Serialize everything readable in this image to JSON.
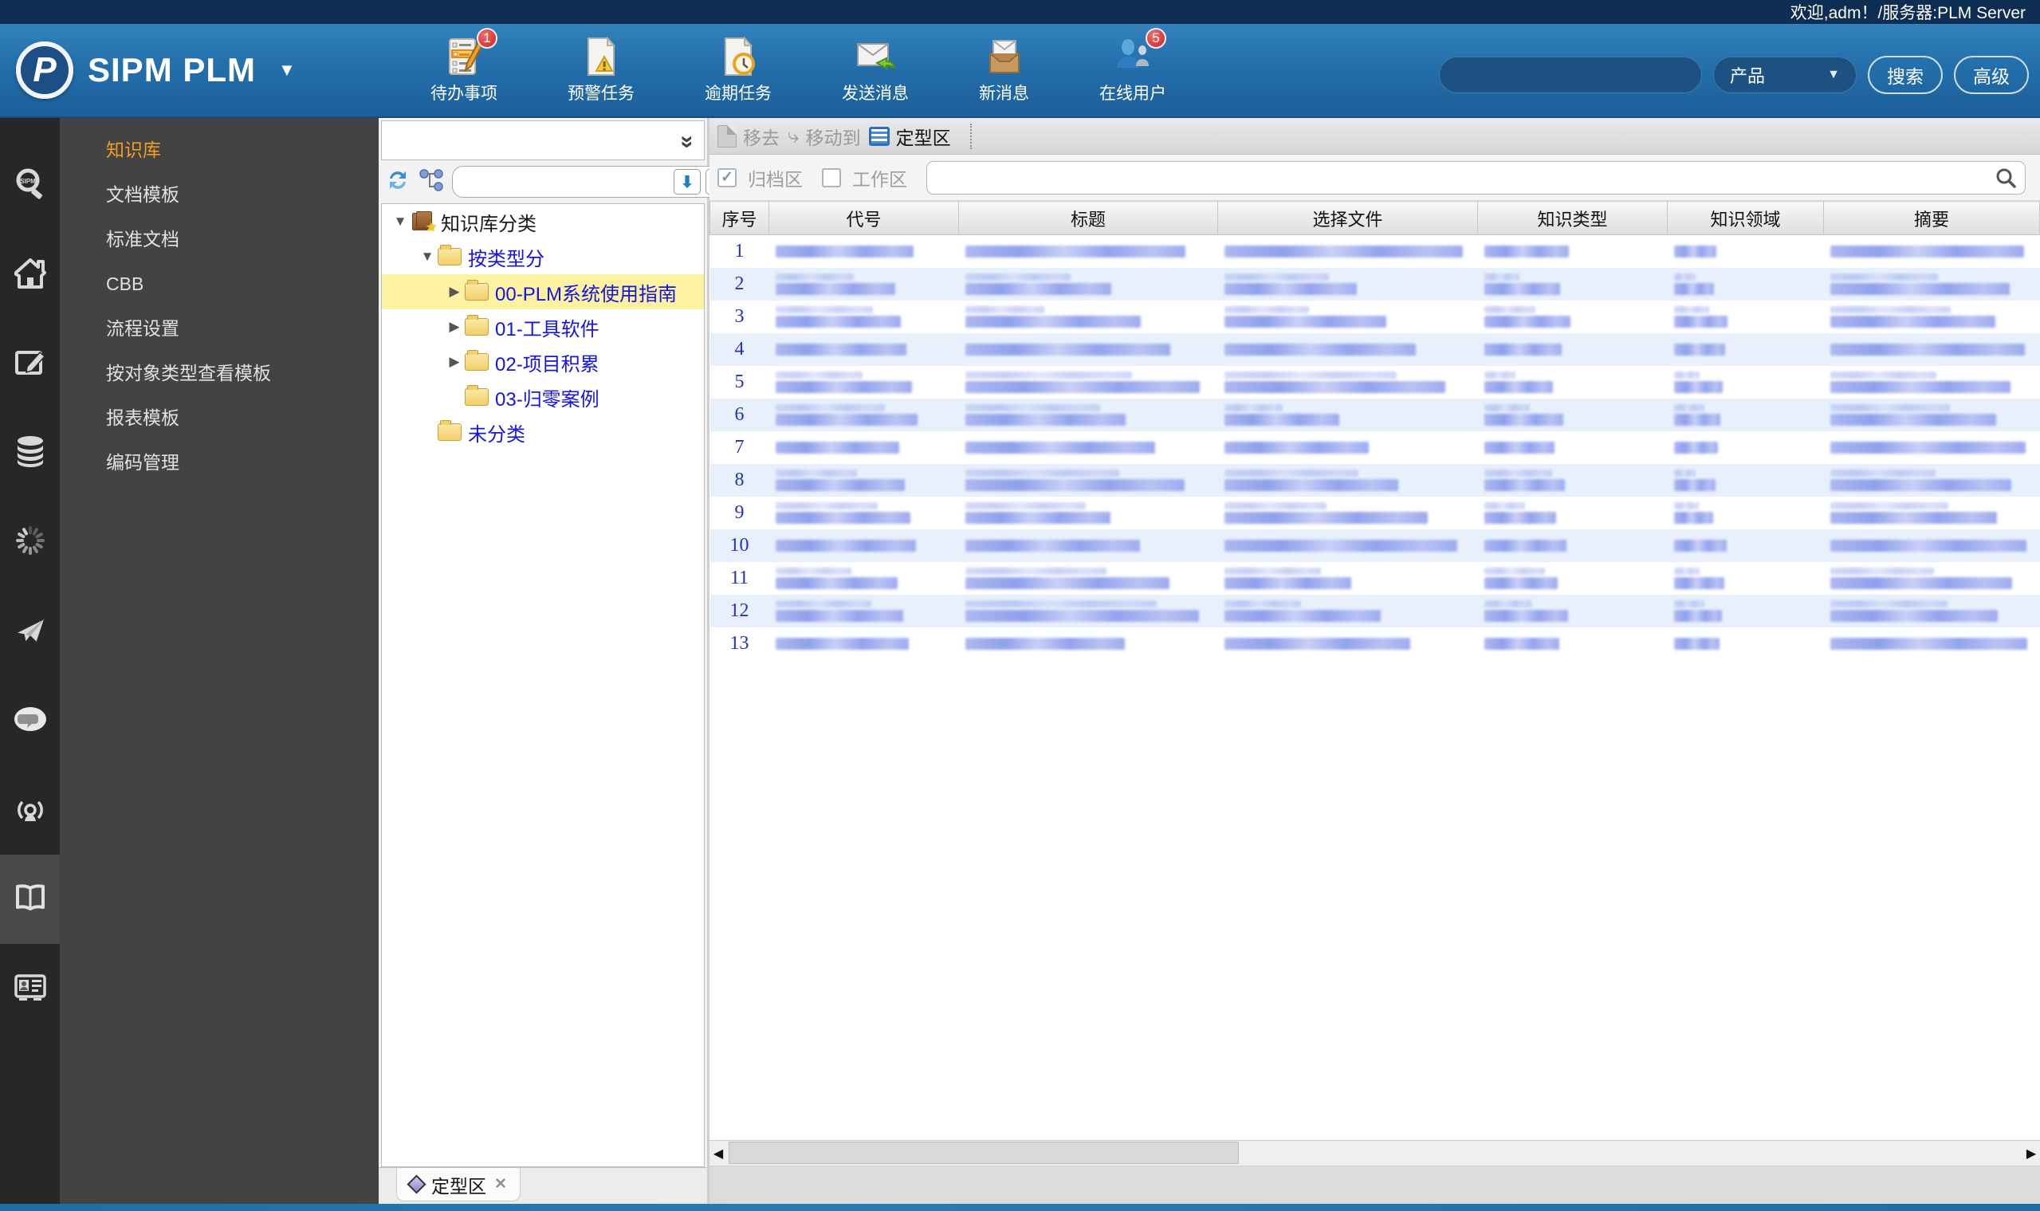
{
  "topbar": {
    "welcome": "欢迎,adm！/服务器:PLM Server"
  },
  "header": {
    "brand": "SIPM PLM",
    "toolbar": [
      {
        "icon": "todo-list-icon",
        "label": "待办事项",
        "badge": "1"
      },
      {
        "icon": "alert-task-icon",
        "label": "预警任务"
      },
      {
        "icon": "overdue-task-icon",
        "label": "逾期任务"
      },
      {
        "icon": "send-message-icon",
        "label": "发送消息"
      },
      {
        "icon": "new-message-icon",
        "label": "新消息"
      },
      {
        "icon": "online-users-icon",
        "label": "在线用户",
        "badge": "5"
      }
    ],
    "search": {
      "value": "",
      "category": "产品",
      "search_label": "搜索",
      "advanced_label": "高级"
    }
  },
  "rail": [
    {
      "icon": "sipm-search-icon",
      "active": false
    },
    {
      "icon": "home-icon",
      "active": false
    },
    {
      "icon": "edit-icon",
      "active": false
    },
    {
      "icon": "database-icon",
      "active": false
    },
    {
      "icon": "spinner-icon",
      "active": false
    },
    {
      "icon": "paper-plane-icon",
      "active": false
    },
    {
      "icon": "chat-icon",
      "active": false
    },
    {
      "icon": "broadcast-icon",
      "active": false
    },
    {
      "icon": "book-icon",
      "active": true
    },
    {
      "icon": "id-card-icon",
      "active": false
    }
  ],
  "sidebar": [
    {
      "label": "知识库",
      "active": true
    },
    {
      "label": "文档模板",
      "active": false
    },
    {
      "label": "标准文档",
      "active": false
    },
    {
      "label": "CBB",
      "active": false
    },
    {
      "label": "流程设置",
      "active": false
    },
    {
      "label": "按对象类型查看模板",
      "active": false
    },
    {
      "label": "报表模板",
      "active": false
    },
    {
      "label": "编码管理",
      "active": false
    }
  ],
  "tree": {
    "nodes": [
      {
        "label": "知识库分类",
        "level": 0,
        "state": "expanded",
        "icon": "library",
        "root": true,
        "selected": false
      },
      {
        "label": "按类型分",
        "level": 1,
        "state": "expanded",
        "icon": "folder",
        "root": false,
        "selected": false
      },
      {
        "label": "00-PLM系统使用指南",
        "level": 2,
        "state": "collapsed",
        "icon": "folder",
        "root": false,
        "selected": true
      },
      {
        "label": "01-工具软件",
        "level": 2,
        "state": "collapsed",
        "icon": "folder",
        "root": false,
        "selected": false
      },
      {
        "label": "02-项目积累",
        "level": 2,
        "state": "collapsed",
        "icon": "folder",
        "root": false,
        "selected": false
      },
      {
        "label": "03-归零案例",
        "level": 2,
        "state": "leaf",
        "icon": "folder",
        "root": false,
        "selected": false
      },
      {
        "label": "未分类",
        "level": 1,
        "state": "leaf",
        "icon": "folder",
        "root": false,
        "selected": false
      }
    ],
    "bottom_tab": {
      "label": "定型区"
    }
  },
  "content": {
    "toolbar": {
      "remove_label": "移去",
      "move_to_label": "移动到",
      "finalize_label": "定型区"
    },
    "filters": {
      "archive_label": "归档区",
      "archive_checked": true,
      "workspace_label": "工作区",
      "workspace_checked": false,
      "search_value": ""
    },
    "table": {
      "columns": [
        "序号",
        "代号",
        "标题",
        "选择文件",
        "知识类型",
        "知识领域",
        "摘要"
      ],
      "rows": [
        {
          "no": "1",
          "redacted": true
        },
        {
          "no": "2",
          "redacted": true
        },
        {
          "no": "3",
          "redacted": true
        },
        {
          "no": "4",
          "redacted": true
        },
        {
          "no": "5",
          "redacted": true
        },
        {
          "no": "6",
          "redacted": true
        },
        {
          "no": "7",
          "redacted": true
        },
        {
          "no": "8",
          "redacted": true
        },
        {
          "no": "9",
          "redacted": true
        },
        {
          "no": "10",
          "redacted": true
        },
        {
          "no": "11",
          "redacted": true
        },
        {
          "no": "12",
          "redacted": true
        },
        {
          "no": "13",
          "redacted": true
        }
      ]
    }
  }
}
